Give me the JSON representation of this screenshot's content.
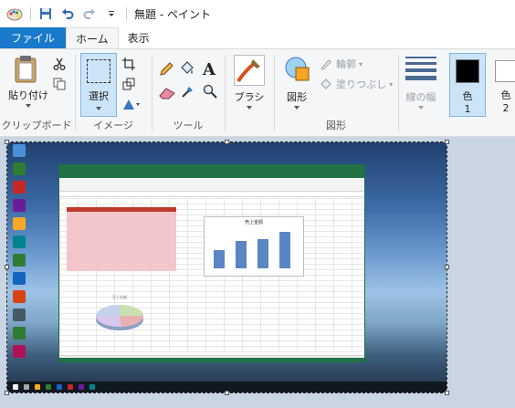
{
  "window": {
    "title": "無題 - ペイント"
  },
  "tabs": [
    "ファイル",
    "ホーム",
    "表示"
  ],
  "ribbon": {
    "clipboard": {
      "paste_label": "貼り付け",
      "group_label": "クリップボード"
    },
    "image": {
      "select_label": "選択",
      "group_label": "イメージ"
    },
    "tools": {
      "group_label": "ツール"
    },
    "brushes": {
      "label": "ブラシ"
    },
    "shapes": {
      "shapes_label": "図形",
      "outline_label": "輪郭",
      "fill_label": "塗りつぶし",
      "group_label": "図形"
    },
    "size": {
      "label": "線の幅"
    },
    "colors": {
      "color1_label": "色",
      "color1_num": "1",
      "color2_label": "色",
      "color2_num": "2",
      "color1": "#000000",
      "color2": "#ffffff"
    }
  },
  "embedded": {
    "chart_title": "売上金額",
    "pie_title": "売上金額"
  },
  "colors": {
    "accent": "#1979ca",
    "excel_green": "#217346"
  }
}
